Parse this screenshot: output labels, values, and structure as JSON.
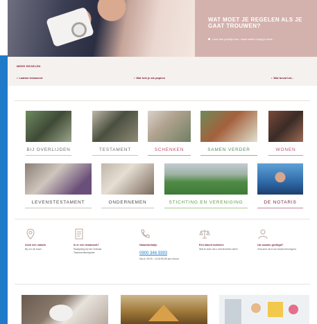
{
  "hero": {
    "title": "WAT MOET JE REGELEN ALS JE GAAT TROUWEN?",
    "bullet": "Lees alle praktijk over, maar welke hoogt je eerst..."
  },
  "meer": {
    "heading": "MEER REGELEN",
    "links": [
      "Laatste testament",
      "Wat heb je als papiers",
      "Wat bevat het..."
    ]
  },
  "tiles_row1": [
    {
      "label": "BIJ OVERLIJDEN",
      "color": "#6d6d6d"
    },
    {
      "label": "TESTAMENT",
      "color": "#6d6d6d"
    },
    {
      "label": "SCHENKEN",
      "color": "#c04a66"
    },
    {
      "label": "SAMEN VERDER",
      "color": "#4f8a5c"
    },
    {
      "label": "WONEN",
      "color": "#c04a66"
    }
  ],
  "tiles_row2": [
    {
      "label": "LEVENSTESTAMENT",
      "color": "#444"
    },
    {
      "label": "ONDERNEMEN",
      "color": "#444"
    },
    {
      "label": "STICHTING EN VERENIGING",
      "color": "#5f9a3d"
    },
    {
      "label": "DE NOTARIS",
      "color": "#7a1b37"
    }
  ],
  "info": [
    {
      "icon": "location-pin-icon",
      "title": "Zoek een notaris",
      "text": "Bij u in de buurt"
    },
    {
      "icon": "document-icon",
      "title": "Is er een testament?",
      "text": "Raadpleeg bij het Centraal Testamentenregister"
    },
    {
      "icon": "phone-icon",
      "title": "Notarisinfolijn",
      "phone": "0900 346 9393",
      "text": "Ma-vr, 09:00 - 14:00 €0,80 per minuut"
    },
    {
      "icon": "scales-icon",
      "title": "Een klacht indienen",
      "text": "Wat te doen als u niet tevreden bent?"
    },
    {
      "icon": "notary-icon",
      "title": "Uw notaris geeltigd?",
      "text": "Vind snel uit of uw notaris bevoegd is"
    }
  ]
}
